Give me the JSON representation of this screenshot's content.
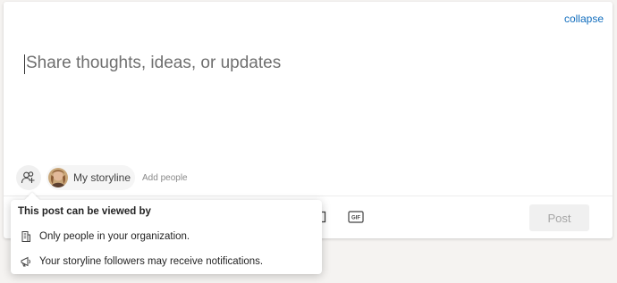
{
  "composer": {
    "collapse_label": "collapse",
    "placeholder": "Share thoughts, ideas, or updates"
  },
  "audience": {
    "audience_icon": "people-add-icon",
    "storyline_label": "My storyline",
    "add_people_label": "Add people"
  },
  "toolbar": {
    "gif_label": "GIF",
    "post_label": "Post"
  },
  "popover": {
    "title": "This post can be viewed by",
    "items": [
      {
        "icon": "building-icon",
        "text": "Only people in your organization."
      },
      {
        "icon": "megaphone-icon",
        "text": "Your storyline followers may receive notifications."
      }
    ]
  },
  "colors": {
    "accent": "#0f6cbd",
    "background": "#f5f3f1"
  }
}
